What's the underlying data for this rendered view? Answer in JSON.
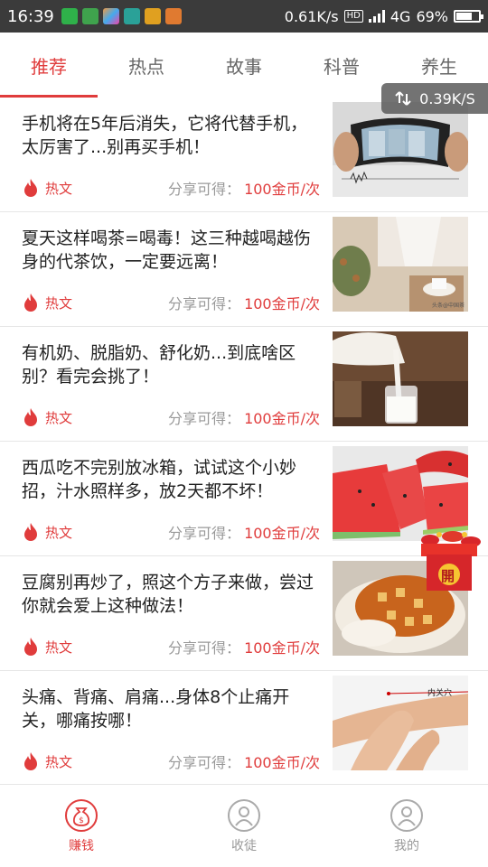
{
  "statusbar": {
    "time": "16:39",
    "netspeed": "0.61K/s",
    "network": "4G",
    "battery": "69%",
    "battery_level": 0.69
  },
  "tabs": [
    {
      "label": "推荐",
      "active": true
    },
    {
      "label": "热点",
      "active": false
    },
    {
      "label": "故事",
      "active": false
    },
    {
      "label": "科普",
      "active": false
    },
    {
      "label": "养生",
      "active": false
    }
  ],
  "speed_overlay": "0.39K/S",
  "articles": [
    {
      "title": "手机将在5年后消失，它将代替手机，太厉害了...别再买手机！",
      "tag": "热文",
      "share_label": "分享可得：",
      "reward": "100金币/次"
    },
    {
      "title": "夏天这样喝茶=喝毒！这三种越喝越伤身的代茶饮，一定要远离！",
      "tag": "热文",
      "share_label": "分享可得：",
      "reward": "100金币/次"
    },
    {
      "title": "有机奶、脱脂奶、舒化奶...到底啥区别？看完会挑了！",
      "tag": "热文",
      "share_label": "分享可得：",
      "reward": "100金币/次"
    },
    {
      "title": "西瓜吃不完别放冰箱，试试这个小妙招，汁水照样多，放2天都不坏！",
      "tag": "热文",
      "share_label": "分享可得：",
      "reward": "100金币/次"
    },
    {
      "title": "豆腐别再炒了，照这个方子来做，尝过你就会爱上这种做法！",
      "tag": "热文",
      "share_label": "分享可得：",
      "reward": "100金币/次"
    },
    {
      "title": "头痛、背痛、肩痛...身体8个止痛开关，哪痛按哪！",
      "tag": "热文",
      "share_label": "分享可得：",
      "reward": "100金币/次"
    }
  ],
  "thumb_texts": {
    "tea_watermark": "头条@中国茶",
    "acupoint_label": "内关穴"
  },
  "envelope": {
    "label": "開"
  },
  "bottomnav": [
    {
      "label": "赚钱",
      "active": true
    },
    {
      "label": "收徒",
      "active": false
    },
    {
      "label": "我的",
      "active": false
    }
  ],
  "colors": {
    "accent": "#e03c3c",
    "statusbar": "#3b3b3b"
  }
}
